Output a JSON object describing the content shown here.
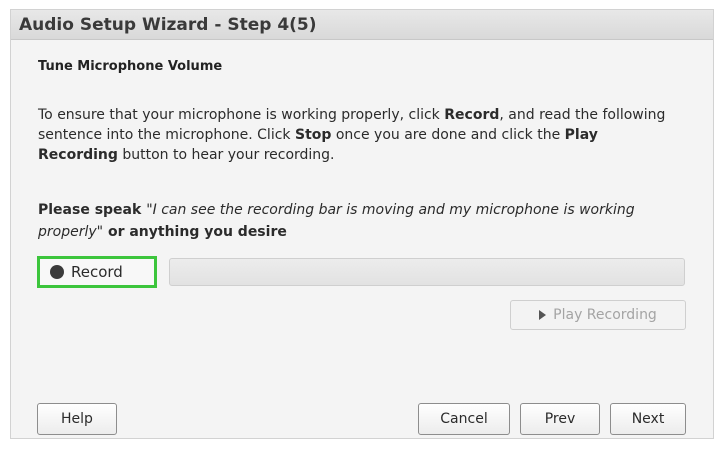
{
  "window": {
    "title": "Audio Setup Wizard - Step 4(5)"
  },
  "section": {
    "title": "Tune Microphone Volume"
  },
  "instructions": {
    "part1": "To ensure that your microphone is working properly, click ",
    "record_word": "Record",
    "part2": ", and read the following sentence into the microphone. Click ",
    "stop_word": "Stop",
    "part3": " once you are done and click the ",
    "play_recording_word": "Play Recording",
    "part4": " button to hear your recording."
  },
  "speak": {
    "lead": "Please speak ",
    "quote": "\"I can see the recording bar is moving and my microphone is working properly\"",
    "tail": " or anything you desire"
  },
  "record_button": {
    "label": "Record",
    "icon": "record-dot-icon"
  },
  "level_meter": {
    "level_percent": 0,
    "accent_color": "#3cc53c"
  },
  "play_button": {
    "label": "Play Recording",
    "icon": "play-icon",
    "enabled": false
  },
  "footer": {
    "help_label": "Help",
    "cancel_label": "Cancel",
    "prev_label": "Prev",
    "next_label": "Next"
  }
}
